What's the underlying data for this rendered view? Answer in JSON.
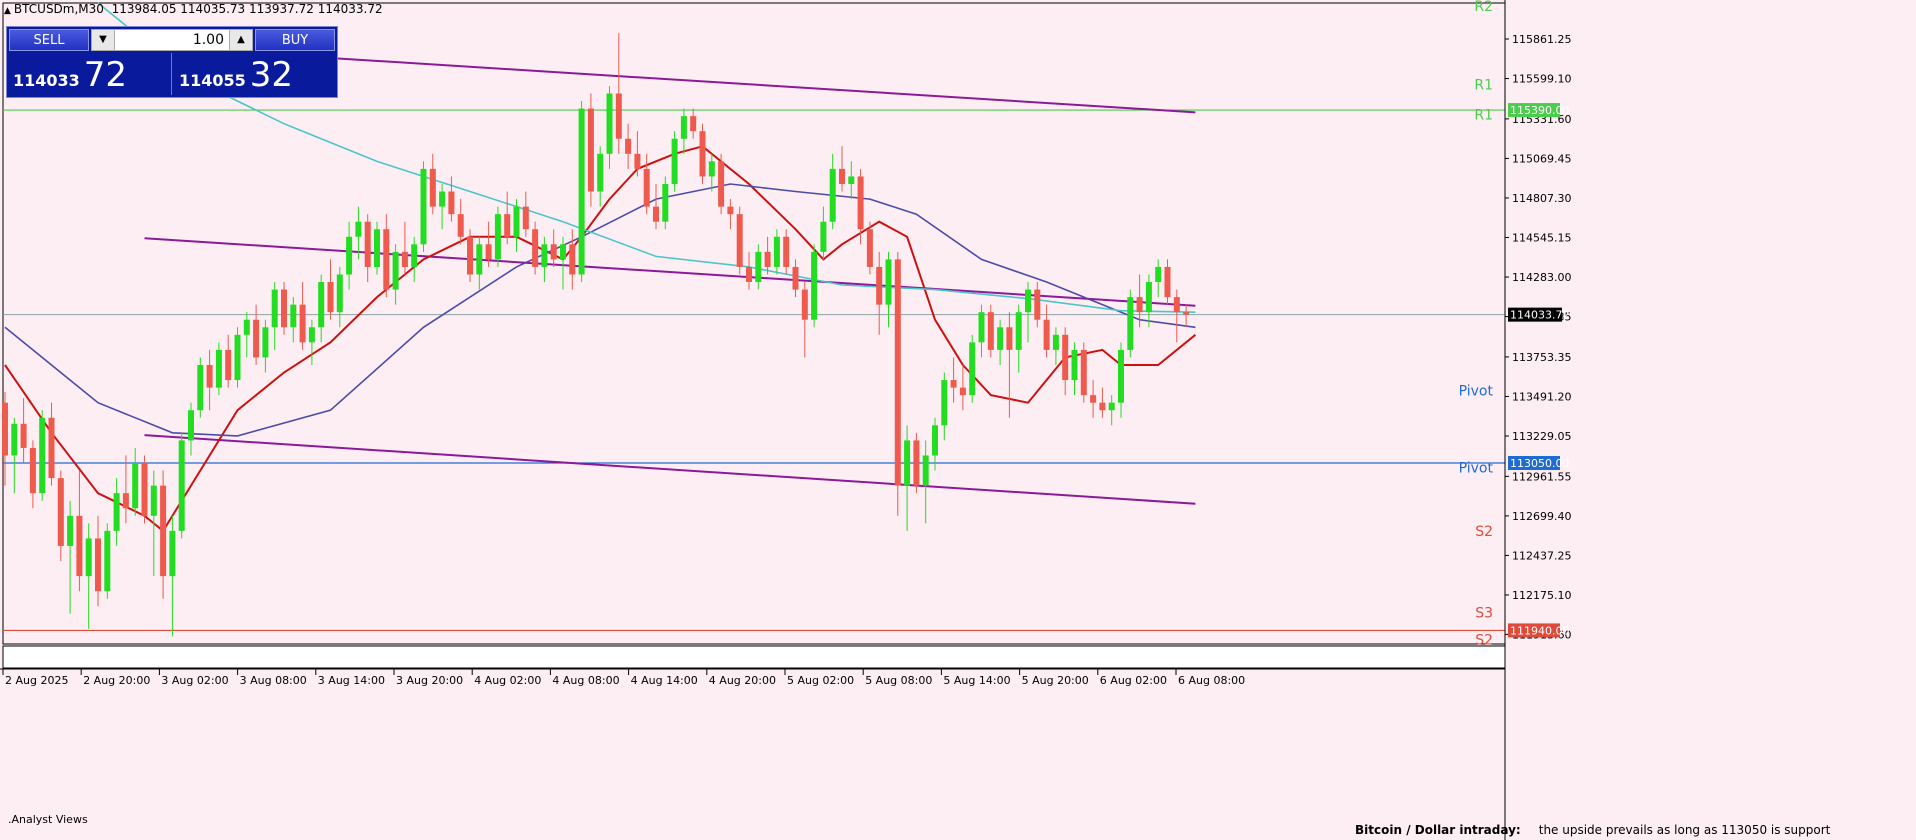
{
  "header": {
    "symbol": "BTCUSDm,M30",
    "ohlc": "113984.05 114035.73 113937.72 114033.72"
  },
  "trade_panel": {
    "sell_label": "SELL",
    "buy_label": "BUY",
    "lot": "1.00",
    "sell_price_small": "114033",
    "sell_price_big": "72",
    "buy_price_small": "114055",
    "buy_price_big": "32"
  },
  "footer": {
    "analyst_label": ".Analyst Views",
    "outlook_title": "Bitcoin / Dollar intraday:",
    "outlook_text": "the upside prevails as long as 113050 is support"
  },
  "colors": {
    "background": "#fdeef3",
    "bull": "#22dd22",
    "bear": "#ee5a4e",
    "ma_red": "#cc1111",
    "ma_blue": "#4b4ba8",
    "ma_cyan": "#4cc5c8",
    "channel": "#8a1a99",
    "resistance": "#4ccc4c",
    "pivot": "#1f6bd1",
    "support": "#e04a3a"
  },
  "chart_data": {
    "type": "candlestick",
    "symbol": "BTCUSDm",
    "timeframe": "M30",
    "ylim": [
      111850,
      116100
    ],
    "y_ticks": [
      "115861.25",
      "115599.10",
      "115331.60",
      "115069.45",
      "114807.30",
      "114545.15",
      "114283.00",
      "114020.85",
      "113753.35",
      "113491.20",
      "113229.05",
      "112961.55",
      "112699.40",
      "112437.25",
      "112175.10",
      "111913.60"
    ],
    "x_ticks": [
      "2 Aug 2025",
      "2 Aug 20:00",
      "3 Aug 02:00",
      "3 Aug 08:00",
      "3 Aug 14:00",
      "3 Aug 20:00",
      "4 Aug 02:00",
      "4 Aug 08:00",
      "4 Aug 14:00",
      "4 Aug 20:00",
      "5 Aug 02:00",
      "5 Aug 08:00",
      "5 Aug 14:00",
      "5 Aug 20:00",
      "6 Aug 02:00",
      "6 Aug 08:00"
    ],
    "current_price": "114033.72",
    "levels": [
      {
        "name": "R1",
        "value": 115390,
        "label": "115390.00",
        "kind": "resistance"
      },
      {
        "name": "Pivot",
        "value": 113050,
        "label": "113050.00",
        "kind": "pivot"
      },
      {
        "name": "S2",
        "value": 111940,
        "label": "111940.00",
        "kind": "support"
      }
    ],
    "pivot_labels": [
      {
        "text": "R2",
        "value": 116080,
        "kind": "resistance"
      },
      {
        "text": "R1",
        "value": 115560,
        "kind": "resistance"
      },
      {
        "text": "R1",
        "value": 115360,
        "kind": "resistance"
      },
      {
        "text": "Pivot",
        "value": 113530,
        "kind": "pivot"
      },
      {
        "text": "Pivot",
        "value": 113020,
        "kind": "pivot"
      },
      {
        "text": "S2",
        "value": 112600,
        "kind": "support"
      },
      {
        "text": "S3",
        "value": 112060,
        "kind": "support"
      },
      {
        "text": "S2",
        "value": 111880,
        "kind": "support"
      }
    ],
    "candles": [
      [
        113450,
        113520,
        112900,
        113100
      ],
      [
        113100,
        113350,
        112850,
        113310
      ],
      [
        113310,
        113480,
        113050,
        113150
      ],
      [
        113150,
        113200,
        112750,
        112850
      ],
      [
        112850,
        113400,
        112800,
        113350
      ],
      [
        113350,
        113450,
        112900,
        112950
      ],
      [
        112950,
        113000,
        112400,
        112500
      ],
      [
        112500,
        112800,
        112050,
        112700
      ],
      [
        112700,
        113000,
        112200,
        112300
      ],
      [
        112300,
        112650,
        111950,
        112550
      ],
      [
        112550,
        112700,
        112100,
        112200
      ],
      [
        112200,
        112650,
        112150,
        112600
      ],
      [
        112600,
        112950,
        112500,
        112850
      ],
      [
        112850,
        113100,
        112650,
        112750
      ],
      [
        112750,
        113150,
        112700,
        113050
      ],
      [
        113050,
        113100,
        112650,
        112700
      ],
      [
        112700,
        113000,
        112300,
        112900
      ],
      [
        112900,
        113000,
        112150,
        112300
      ],
      [
        112300,
        112700,
        111900,
        112600
      ],
      [
        112600,
        113250,
        112550,
        113200
      ],
      [
        113200,
        113450,
        113100,
        113400
      ],
      [
        113400,
        113750,
        113350,
        113700
      ],
      [
        113700,
        113800,
        113400,
        113550
      ],
      [
        113550,
        113850,
        113500,
        113800
      ],
      [
        113800,
        113900,
        113550,
        113600
      ],
      [
        113600,
        113950,
        113550,
        113900
      ],
      [
        113900,
        114050,
        113750,
        114000
      ],
      [
        114000,
        114100,
        113700,
        113750
      ],
      [
        113750,
        114000,
        113650,
        113950
      ],
      [
        113950,
        114250,
        113800,
        114200
      ],
      [
        114200,
        114250,
        113900,
        113950
      ],
      [
        113950,
        114150,
        113850,
        114100
      ],
      [
        114100,
        114250,
        113800,
        113850
      ],
      [
        113850,
        114000,
        113700,
        113950
      ],
      [
        113950,
        114300,
        113850,
        114250
      ],
      [
        114250,
        114400,
        114000,
        114050
      ],
      [
        114050,
        114350,
        113950,
        114300
      ],
      [
        114300,
        114650,
        114200,
        114550
      ],
      [
        114550,
        114750,
        114400,
        114650
      ],
      [
        114650,
        114700,
        114250,
        114350
      ],
      [
        114350,
        114650,
        114300,
        114600
      ],
      [
        114600,
        114700,
        114150,
        114200
      ],
      [
        114200,
        114500,
        114100,
        114450
      ],
      [
        114450,
        114650,
        114300,
        114350
      ],
      [
        114350,
        114550,
        114250,
        114500
      ],
      [
        114500,
        115050,
        114450,
        115000
      ],
      [
        115000,
        115100,
        114700,
        114750
      ],
      [
        114750,
        114900,
        114600,
        114850
      ],
      [
        114850,
        114950,
        114650,
        114700
      ],
      [
        114700,
        114800,
        114500,
        114550
      ],
      [
        114550,
        114600,
        114250,
        114300
      ],
      [
        114300,
        114550,
        114200,
        114500
      ],
      [
        114500,
        114650,
        114350,
        114400
      ],
      [
        114400,
        114750,
        114350,
        114700
      ],
      [
        114700,
        114850,
        114500,
        114550
      ],
      [
        114550,
        114800,
        114450,
        114750
      ],
      [
        114750,
        114850,
        114550,
        114600
      ],
      [
        114600,
        114650,
        114300,
        114350
      ],
      [
        114350,
        114550,
        114250,
        114500
      ],
      [
        114500,
        114600,
        114350,
        114400
      ],
      [
        114400,
        114550,
        114200,
        114500
      ],
      [
        114500,
        114600,
        114200,
        114300
      ],
      [
        114300,
        115450,
        114250,
        115400
      ],
      [
        115400,
        115500,
        114750,
        114850
      ],
      [
        114850,
        115150,
        114750,
        115100
      ],
      [
        115100,
        115550,
        115000,
        115500
      ],
      [
        115500,
        115900,
        115100,
        115200
      ],
      [
        115200,
        115300,
        115000,
        115100
      ],
      [
        115100,
        115250,
        114950,
        115000
      ],
      [
        115000,
        115100,
        114700,
        114750
      ],
      [
        114750,
        114900,
        114600,
        114650
      ],
      [
        114650,
        114950,
        114600,
        114900
      ],
      [
        114900,
        115250,
        114850,
        115200
      ],
      [
        115200,
        115400,
        115100,
        115350
      ],
      [
        115350,
        115400,
        115200,
        115250
      ],
      [
        115250,
        115300,
        114900,
        114950
      ],
      [
        114950,
        115100,
        114850,
        115050
      ],
      [
        115050,
        115100,
        114700,
        114750
      ],
      [
        114750,
        114800,
        114600,
        114700
      ],
      [
        114700,
        114750,
        114300,
        114350
      ],
      [
        114350,
        114450,
        114200,
        114250
      ],
      [
        114250,
        114500,
        114200,
        114450
      ],
      [
        114450,
        114550,
        114300,
        114350
      ],
      [
        114350,
        114600,
        114300,
        114550
      ],
      [
        114550,
        114600,
        114300,
        114350
      ],
      [
        114350,
        114400,
        114150,
        114200
      ],
      [
        114200,
        114250,
        113750,
        114000
      ],
      [
        114000,
        114500,
        113950,
        114450
      ],
      [
        114450,
        114750,
        114400,
        114650
      ],
      [
        114650,
        115100,
        114600,
        115000
      ],
      [
        115000,
        115150,
        114850,
        114900
      ],
      [
        114900,
        115050,
        114800,
        114950
      ],
      [
        114950,
        115000,
        114500,
        114600
      ],
      [
        114600,
        114650,
        114300,
        114350
      ],
      [
        114350,
        114450,
        113900,
        114100
      ],
      [
        114100,
        114450,
        113950,
        114400
      ],
      [
        114400,
        114450,
        112700,
        112900
      ],
      [
        112900,
        113300,
        112600,
        113200
      ],
      [
        113200,
        113250,
        112850,
        112900
      ],
      [
        112900,
        113200,
        112650,
        113100
      ],
      [
        113100,
        113350,
        113000,
        113300
      ],
      [
        113300,
        113650,
        113200,
        113600
      ],
      [
        113600,
        113750,
        113450,
        113550
      ],
      [
        113550,
        113700,
        113400,
        113500
      ],
      [
        113500,
        113900,
        113450,
        113850
      ],
      [
        113850,
        114100,
        113750,
        114050
      ],
      [
        114050,
        114100,
        113750,
        113800
      ],
      [
        113800,
        114000,
        113700,
        113950
      ],
      [
        113950,
        114050,
        113350,
        113800
      ],
      [
        113800,
        114100,
        113650,
        114050
      ],
      [
        114050,
        114250,
        113850,
        114200
      ],
      [
        114200,
        114250,
        113950,
        114000
      ],
      [
        114000,
        114100,
        113750,
        113800
      ],
      [
        113800,
        113950,
        113700,
        113900
      ],
      [
        113900,
        113950,
        113500,
        113600
      ],
      [
        113600,
        113850,
        113500,
        113800
      ],
      [
        113800,
        113850,
        113450,
        113500
      ],
      [
        113500,
        113600,
        113350,
        113450
      ],
      [
        113450,
        113550,
        113350,
        113400
      ],
      [
        113400,
        113500,
        113300,
        113450
      ],
      [
        113450,
        113850,
        113350,
        113800
      ],
      [
        113800,
        114200,
        113750,
        114150
      ],
      [
        114150,
        114300,
        113950,
        114050
      ],
      [
        114050,
        114300,
        113950,
        114250
      ],
      [
        114250,
        114400,
        114150,
        114350
      ],
      [
        114350,
        114400,
        114100,
        114150
      ],
      [
        114150,
        114200,
        113850,
        114050
      ],
      [
        114050,
        114100,
        113950,
        114033.72
      ]
    ],
    "moving_averages": [
      {
        "color": "#cc1111",
        "values": [
          [
            0,
            113700
          ],
          [
            5,
            113250
          ],
          [
            10,
            112850
          ],
          [
            15,
            112700
          ],
          [
            17,
            112600
          ],
          [
            20,
            112900
          ],
          [
            25,
            113400
          ],
          [
            30,
            113650
          ],
          [
            35,
            113850
          ],
          [
            40,
            114150
          ],
          [
            45,
            114400
          ],
          [
            50,
            114550
          ],
          [
            55,
            114550
          ],
          [
            60,
            114400
          ],
          [
            62,
            114550
          ],
          [
            65,
            114800
          ],
          [
            68,
            115000
          ],
          [
            72,
            115100
          ],
          [
            75,
            115150
          ],
          [
            80,
            114900
          ],
          [
            85,
            114600
          ],
          [
            88,
            114400
          ],
          [
            90,
            114500
          ],
          [
            94,
            114650
          ],
          [
            97,
            114550
          ],
          [
            100,
            114000
          ],
          [
            103,
            113700
          ],
          [
            106,
            113500
          ],
          [
            110,
            113450
          ],
          [
            114,
            113750
          ],
          [
            118,
            113800
          ],
          [
            120,
            113700
          ],
          [
            124,
            113700
          ],
          [
            128,
            113900
          ]
        ]
      },
      {
        "color": "#4b4ba8",
        "values": [
          [
            0,
            113950
          ],
          [
            10,
            113450
          ],
          [
            18,
            113250
          ],
          [
            25,
            113230
          ],
          [
            35,
            113400
          ],
          [
            45,
            113950
          ],
          [
            55,
            114350
          ],
          [
            62,
            114550
          ],
          [
            70,
            114800
          ],
          [
            78,
            114900
          ],
          [
            85,
            114850
          ],
          [
            93,
            114800
          ],
          [
            98,
            114700
          ],
          [
            105,
            114400
          ],
          [
            112,
            114250
          ],
          [
            118,
            114100
          ],
          [
            122,
            114000
          ],
          [
            128,
            113950
          ]
        ]
      },
      {
        "color": "#4cc5c8",
        "values": [
          [
            10,
            116100
          ],
          [
            20,
            115600
          ],
          [
            30,
            115300
          ],
          [
            40,
            115050
          ],
          [
            50,
            114850
          ],
          [
            60,
            114650
          ],
          [
            70,
            114420
          ],
          [
            80,
            114350
          ],
          [
            90,
            114230
          ],
          [
            100,
            114200
          ],
          [
            110,
            114140
          ],
          [
            120,
            114060
          ],
          [
            128,
            114050
          ]
        ]
      }
    ],
    "channel_lines": [
      {
        "from": [
          17,
          115805
        ],
        "to": [
          128,
          115375
        ]
      },
      {
        "from": [
          15,
          114540
        ],
        "to": [
          128,
          114093
        ]
      },
      {
        "from": [
          15,
          113235
        ],
        "to": [
          128,
          112780
        ]
      }
    ]
  }
}
